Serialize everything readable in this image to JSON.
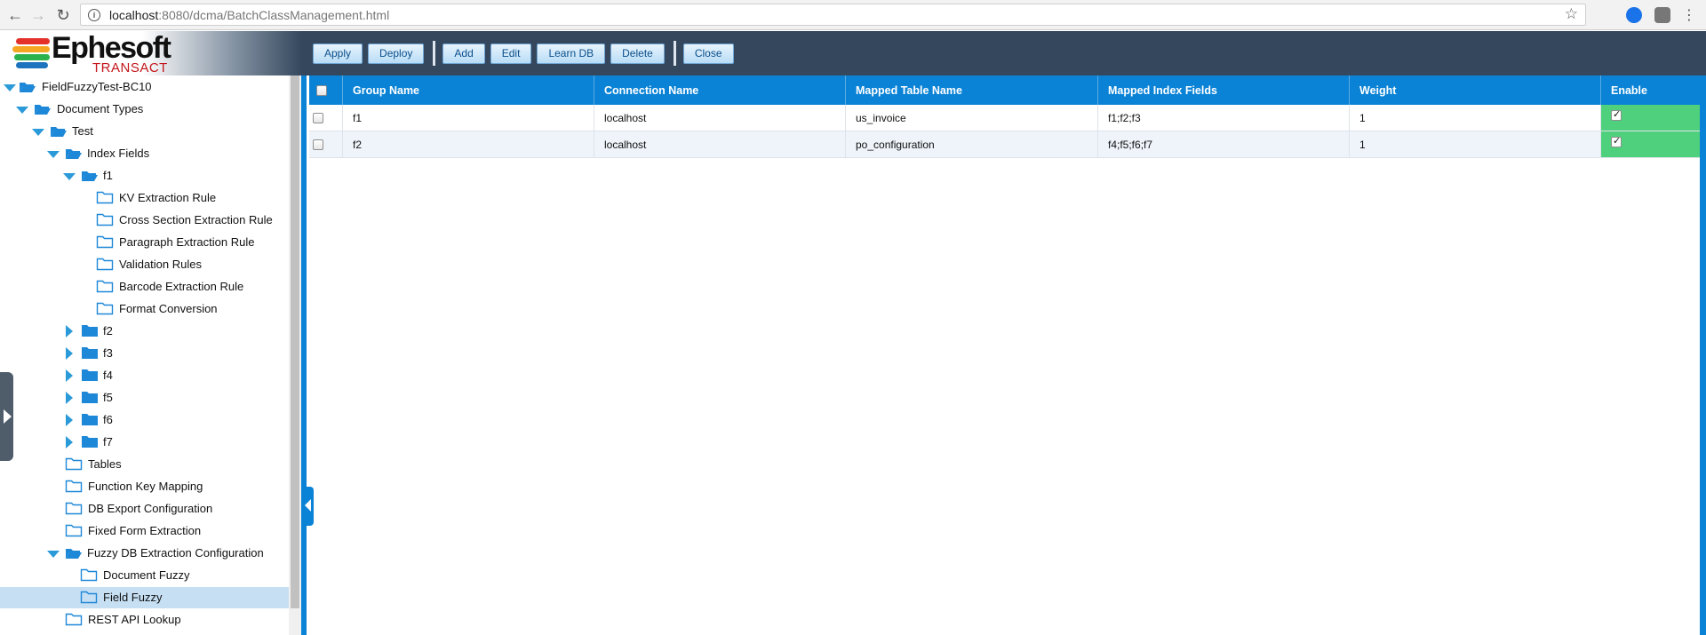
{
  "browser": {
    "url_host": "localhost",
    "url_rest": ":8080/dcma/BatchClassManagement.html"
  },
  "app": {
    "logo_name": "Ephesoft",
    "logo_sub": "TRANSACT",
    "colors": {
      "header_dark": "#34475d",
      "accent_blue": "#0a83d6",
      "enable_green": "#4fd07c",
      "logo_red": "#c4161c"
    }
  },
  "toolbar": {
    "apply": "Apply",
    "deploy": "Deploy",
    "add": "Add",
    "edit": "Edit",
    "learn_db": "Learn DB",
    "delete": "Delete",
    "close": "Close"
  },
  "tree": {
    "root": "FieldFuzzyTest-BC10",
    "document_types": "Document Types",
    "test": "Test",
    "index_fields": "Index Fields",
    "f1": "f1",
    "kv": "KV Extraction Rule",
    "cross": "Cross Section Extraction Rule",
    "paragraph": "Paragraph Extraction Rule",
    "validation": "Validation Rules",
    "barcode": "Barcode Extraction Rule",
    "format": "Format Conversion",
    "f2": "f2",
    "f3": "f3",
    "f4": "f4",
    "f5": "f5",
    "f6": "f6",
    "f7": "f7",
    "tables": "Tables",
    "function_key": "Function Key Mapping",
    "db_export": "DB Export Configuration",
    "fixed_form": "Fixed Form Extraction",
    "fuzzy_db": "Fuzzy DB Extraction Configuration",
    "document_fuzzy": "Document Fuzzy",
    "field_fuzzy": "Field Fuzzy",
    "rest_api": "REST API Lookup"
  },
  "grid": {
    "headers": {
      "group_name": "Group Name",
      "connection_name": "Connection Name",
      "mapped_table_name": "Mapped Table Name",
      "mapped_index_fields": "Mapped Index Fields",
      "weight": "Weight",
      "enable": "Enable"
    },
    "rows": [
      {
        "group": "f1",
        "connection": "localhost",
        "table": "us_invoice",
        "fields": "f1;f2;f3",
        "weight": "1",
        "enabled": true
      },
      {
        "group": "f2",
        "connection": "localhost",
        "table": "po_configuration",
        "fields": "f4;f5;f6;f7",
        "weight": "1",
        "enabled": true
      }
    ]
  }
}
